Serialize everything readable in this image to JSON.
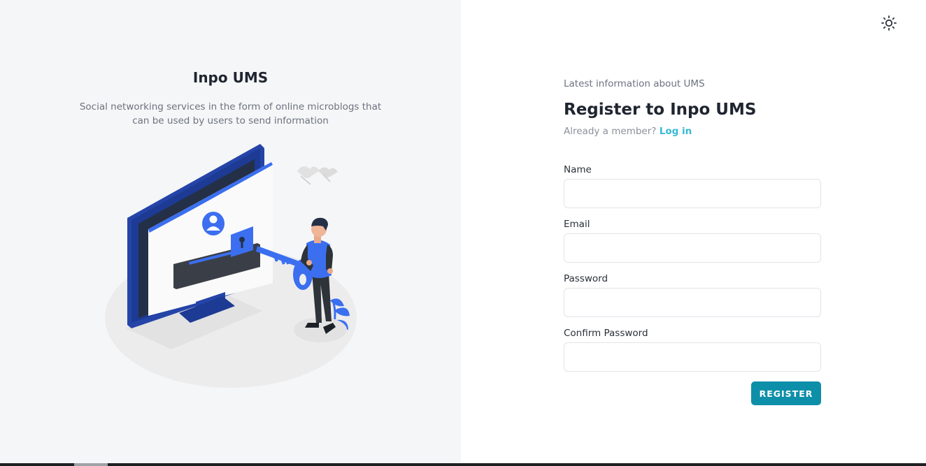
{
  "left": {
    "title": "Inpo UMS",
    "description": "Social networking services in the form of online microblogs that can be used by users to send information",
    "illustration": "monitor-login-with-key-illustration"
  },
  "header": {
    "theme_icon": "sun-icon"
  },
  "form": {
    "eyebrow": "Latest information about UMS",
    "title": "Register to Inpo UMS",
    "member_prefix": "Already a member?",
    "login_label": "Log in",
    "fields": [
      {
        "label": "Name",
        "value": "",
        "placeholder": ""
      },
      {
        "label": "Email",
        "value": "",
        "placeholder": ""
      },
      {
        "label": "Password",
        "value": "",
        "placeholder": ""
      },
      {
        "label": "Confirm Password",
        "value": "",
        "placeholder": ""
      }
    ],
    "submit_label": "REGISTER"
  },
  "colors": {
    "accent": "#0e8fa9",
    "link": "#36b9d6",
    "illustration_blue": "#3b6ff0"
  }
}
